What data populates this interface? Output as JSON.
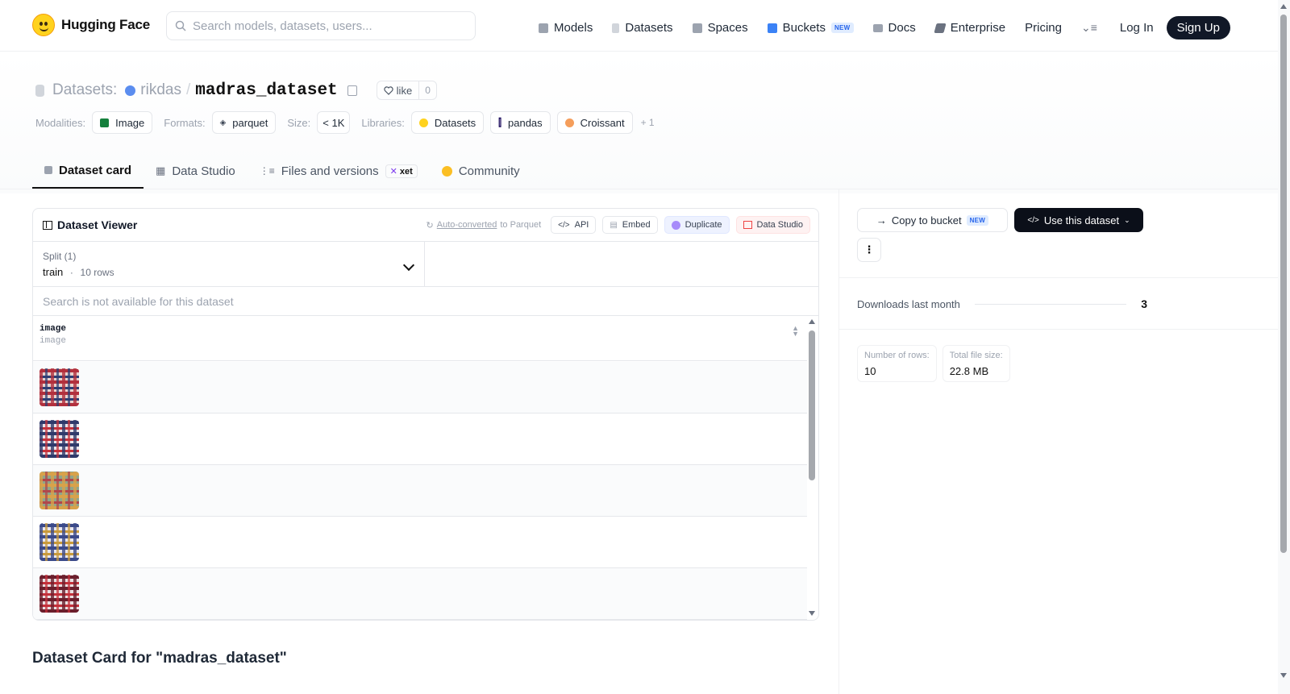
{
  "nav": {
    "brand": "Hugging Face",
    "search_placeholder": "Search models, datasets, users...",
    "items": [
      {
        "label": "Models",
        "icon": "models-icon",
        "color": "#9ca3af"
      },
      {
        "label": "Datasets",
        "icon": "datasets-icon",
        "color": "#d1d5db"
      },
      {
        "label": "Spaces",
        "icon": "spaces-icon",
        "color": "#9ca3af"
      },
      {
        "label": "Buckets",
        "icon": "buckets-icon",
        "color": "#3b82f6",
        "badge": "NEW"
      },
      {
        "label": "Docs",
        "icon": "docs-icon",
        "color": "#9ca3af"
      },
      {
        "label": "Enterprise",
        "icon": "enterprise-icon",
        "color": "#6b7280"
      },
      {
        "label": "Pricing"
      }
    ],
    "login": "Log In",
    "signup": "Sign Up"
  },
  "repo": {
    "prefix": "Datasets:",
    "owner": "rikdas",
    "slash": "/",
    "name": "madras_dataset",
    "like_label": "like",
    "like_count": "0"
  },
  "meta": {
    "modalities_label": "Modalities:",
    "modality": "Image",
    "formats_label": "Formats:",
    "format": "parquet",
    "size_label": "Size:",
    "size": "< 1K",
    "libraries_label": "Libraries:",
    "libraries": [
      "Datasets",
      "pandas",
      "Croissant"
    ],
    "more": "+ 1"
  },
  "tabs": [
    {
      "label": "Dataset card",
      "active": true
    },
    {
      "label": "Data Studio"
    },
    {
      "label": "Files and versions",
      "badge": "xet"
    },
    {
      "label": "Community"
    }
  ],
  "viewer": {
    "title": "Dataset Viewer",
    "auto_prefix": "Auto-converted",
    "auto_suffix": "to Parquet",
    "api": "API",
    "embed": "Embed",
    "duplicate": "Duplicate",
    "data_studio": "Data Studio",
    "split_label": "Split (1)",
    "split_name": "train",
    "split_sep": "·",
    "split_rows": "10 rows",
    "search_na": "Search is not available for this dataset",
    "column": {
      "name": "image",
      "type": "image"
    },
    "thumbs": [
      {
        "c1": "#b2303d",
        "c2": "#2d3e74",
        "c3": "#e9d2cd"
      },
      {
        "c1": "#2f3a6b",
        "c2": "#c5323c",
        "c3": "#e8e4ea"
      },
      {
        "c1": "#d8a24a",
        "c2": "#b0474c",
        "c3": "#8fa58a"
      },
      {
        "c1": "#3b4a8a",
        "c2": "#c99a3b",
        "c3": "#e8e6ee"
      },
      {
        "c1": "#6b1e2c",
        "c2": "#c4303a",
        "c3": "#e9e0e2"
      }
    ]
  },
  "card_title": "Dataset Card for \"madras_dataset\"",
  "sidebar": {
    "copy_bucket": "Copy to bucket",
    "copy_badge": "NEW",
    "use_dataset": "Use this dataset",
    "downloads_label": "Downloads last month",
    "downloads_value": "3",
    "rows_label": "Number of rows:",
    "rows_value": "10",
    "filesize_label": "Total file size:",
    "filesize_value": "22.8 MB"
  }
}
